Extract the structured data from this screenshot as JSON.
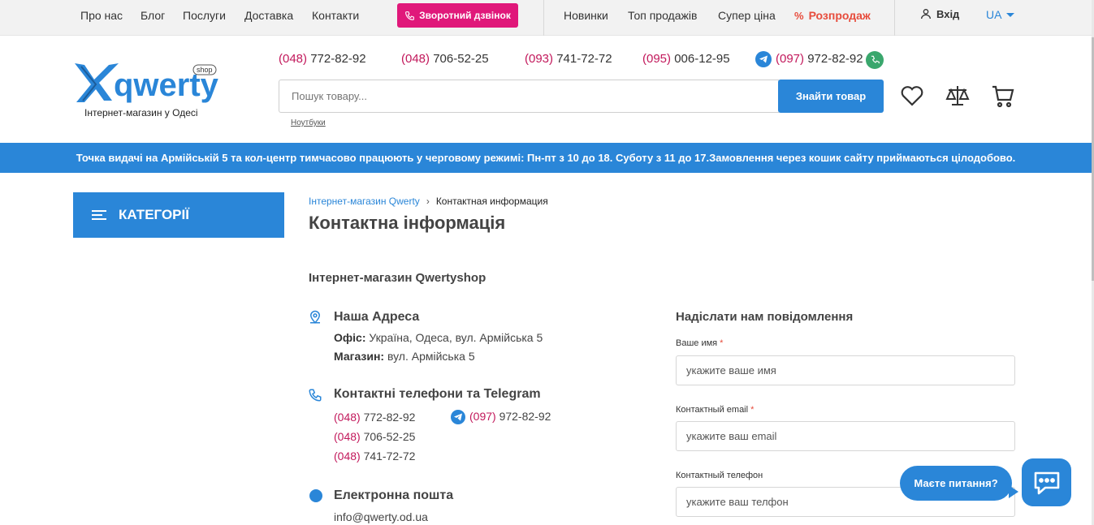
{
  "topbar": {
    "left_links": [
      "Про нас",
      "Блог",
      "Послуги",
      "Доставка",
      "Контакти"
    ],
    "callback_label": "Зворотний дзвінок",
    "right_links": [
      "Новинки",
      "Топ продажів",
      "Супер ціна"
    ],
    "sale_icon": "%",
    "sale_label": "Розпродаж",
    "login_label": "Вхід",
    "lang": "UA"
  },
  "header": {
    "logo_text": "qwerty",
    "logo_badge": "shop",
    "tagline": "Інтернет-магазин у Одесі",
    "phones": [
      {
        "code": "(048)",
        "number": "772-82-92"
      },
      {
        "code": "(048)",
        "number": "706-52-25"
      },
      {
        "code": "(093)",
        "number": "741-72-72"
      },
      {
        "code": "(095)",
        "number": "006-12-95"
      },
      {
        "code": "(097)",
        "number": "972-82-92"
      }
    ],
    "search_placeholder": "Пошук товару...",
    "search_button": "Знайти товар",
    "search_hint": "Ноутбуки"
  },
  "notice": "Точка видачі на Армійській 5 та кол-центр тимчасово працюють у черговому режимі: Пн-пт з 10 до 18. Суботу з 11 до 17.Замовлення через кошик сайту приймаються цілодобово.",
  "categories_label": "КАТЕГОРІЇ",
  "breadcrumb": {
    "home": "Інтернет-магазин Qwerty",
    "current": "Контактная информация"
  },
  "page_title": "Контактна інформація",
  "store_name": "Інтернет-магазин Qwertyshop",
  "address": {
    "title": "Наша Адреса",
    "office_label": "Офіс:",
    "office_value": " Україна, Одеса, вул. Армійська 5",
    "shop_label": "Магазин:",
    "shop_value": " вул. Армійська 5"
  },
  "contacts": {
    "title": "Контактні телефони та Telegram",
    "phones": [
      {
        "code": "(048)",
        "number": " 772-82-92"
      },
      {
        "code": "(048)",
        "number": " 706-52-25"
      },
      {
        "code": "(048)",
        "number": " 741-72-72"
      }
    ],
    "telegram": {
      "code": "(097)",
      "number": " 972-82-92"
    }
  },
  "email": {
    "title": "Електронна пошта",
    "value": "info@qwerty.od.ua"
  },
  "form": {
    "title": "Надіслати нам повідомлення",
    "name_label": "Ваше имя",
    "name_placeholder": "укажите ваше имя",
    "email_label": "Контактный email",
    "email_placeholder": "укажите ваш email",
    "phone_label": "Контактный телефон",
    "phone_placeholder": "укажите ваш телфон",
    "required_mark": "*"
  },
  "chat": {
    "bubble": "Маєте питання?"
  },
  "colors": {
    "accent": "#2a86d8",
    "pink": "#e0187a",
    "sale": "#e74c3c",
    "phone_code": "#c2185b"
  }
}
